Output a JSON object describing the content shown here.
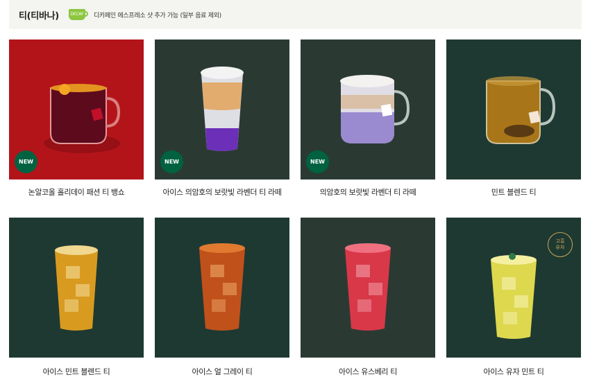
{
  "category": {
    "title": "티(티바나)",
    "decaf_badge": "DECAF",
    "decaf_note": "디카페인 에스프레소 샷 추가 가능 (일부 음료 제외)"
  },
  "colors": {
    "red_bg": "#b3141a",
    "dark_green_bg": "#2a3a33",
    "forest_bg": "#1e3932",
    "new_badge": "#006241",
    "decaf_green": "#8cc63f"
  },
  "products": [
    {
      "name": "논알코올 홀리데이 패션 티 뱅쇼",
      "badge": "NEW",
      "bg": "#b3141a",
      "drink": "hot-red-tea-icon"
    },
    {
      "name": "아이스 의암호의 보랏빛 라벤더 티 라떼",
      "badge": "NEW",
      "bg": "#2a3a33",
      "drink": "iced-lavender-latte-icon"
    },
    {
      "name": "의암호의 보랏빛 라벤더 티 라떼",
      "badge": "NEW",
      "bg": "#2a3a33",
      "drink": "hot-lavender-latte-icon"
    },
    {
      "name": "민트 블렌드 티",
      "badge": "",
      "bg": "#1e3932",
      "drink": "hot-mint-tea-icon"
    },
    {
      "name": "아이스 민트 블렌드 티",
      "badge": "",
      "bg": "#1e3932",
      "drink": "iced-mint-tea-icon"
    },
    {
      "name": "아이스 얼 그레이 티",
      "badge": "",
      "bg": "#1e3932",
      "drink": "iced-earl-grey-icon"
    },
    {
      "name": "아이스 유스베리 티",
      "badge": "",
      "bg": "#2a3a33",
      "drink": "iced-youthberry-icon"
    },
    {
      "name": "아이스 유자 민트 티",
      "badge_special": "고흥\n유자",
      "bg": "#1e3932",
      "drink": "iced-yuzu-mint-icon"
    }
  ]
}
